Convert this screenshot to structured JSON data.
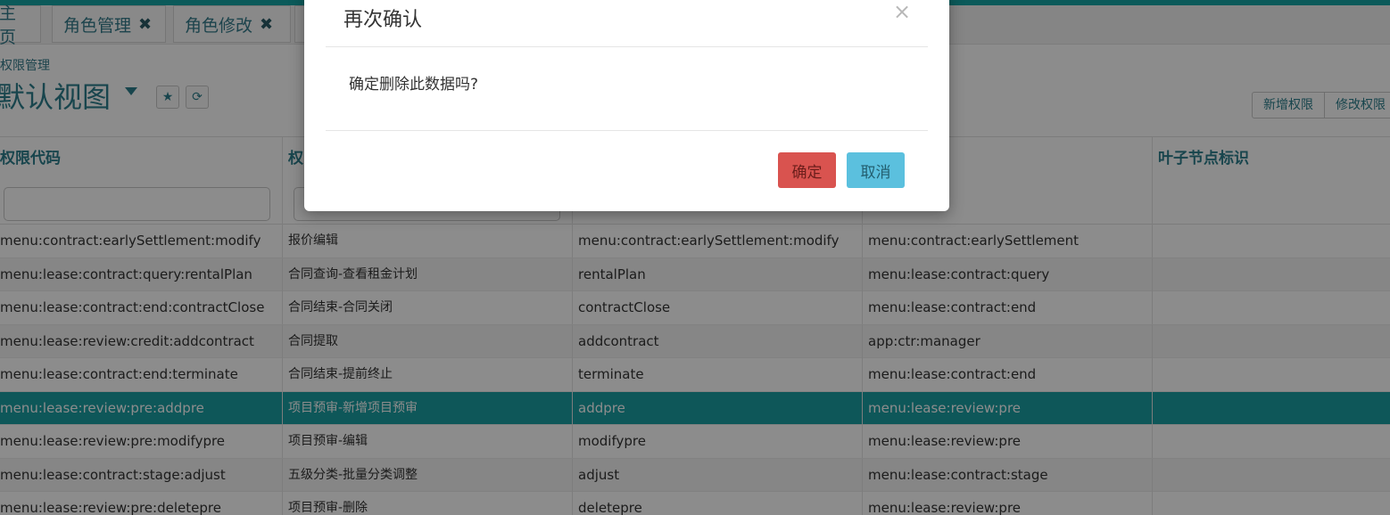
{
  "tabs": [
    {
      "label": "主页"
    },
    {
      "label": "角色管理",
      "close": "✖"
    },
    {
      "label": "角色修改",
      "close": "✖"
    }
  ],
  "breadcrumb": "权限管理",
  "view": {
    "title": "默认视图"
  },
  "toolbar": {
    "add_permission": "新增权限",
    "edit_permission": "修改权限"
  },
  "table": {
    "columns": [
      "权限代码",
      "权限名称",
      "",
      "",
      "叶子节点标识"
    ],
    "rows": [
      [
        "menu:contract:earlySettlement:modify",
        "报价编辑",
        "menu:contract:earlySettlement:modify",
        "menu:contract:earlySettlement",
        ""
      ],
      [
        "menu:lease:contract:query:rentalPlan",
        "合同查询-查看租金计划",
        "rentalPlan",
        "menu:lease:contract:query",
        ""
      ],
      [
        "menu:lease:contract:end:contractClose",
        "合同结束-合同关闭",
        "contractClose",
        "menu:lease:contract:end",
        ""
      ],
      [
        "menu:lease:review:credit:addcontract",
        "合同提取",
        "addcontract",
        "app:ctr:manager",
        ""
      ],
      [
        "menu:lease:contract:end:terminate",
        "合同结束-提前终止",
        "terminate",
        "menu:lease:contract:end",
        ""
      ],
      [
        "menu:lease:review:pre:addpre",
        "项目预审-新增项目预审",
        "addpre",
        "menu:lease:review:pre",
        ""
      ],
      [
        "menu:lease:review:pre:modifypre",
        "项目预审-编辑",
        "modifypre",
        "menu:lease:review:pre",
        ""
      ],
      [
        "menu:lease:contract:stage:adjust",
        "五级分类-批量分类调整",
        "adjust",
        "menu:lease:contract:stage",
        ""
      ],
      [
        "menu:lease:review:pre:deletepre",
        "项目预审-删除",
        "deletepre",
        "menu:lease:review:pre",
        ""
      ]
    ],
    "header_col4_suffix": "码"
  },
  "modal": {
    "title": "再次确认",
    "close": "×",
    "message": "确定删除此数据吗?",
    "confirm": "确定",
    "cancel": "取消"
  },
  "colors": {
    "accent": "#15a4a4",
    "selected_row": "#1a9ea3",
    "danger": "#d9534f",
    "info": "#5bc0de"
  }
}
